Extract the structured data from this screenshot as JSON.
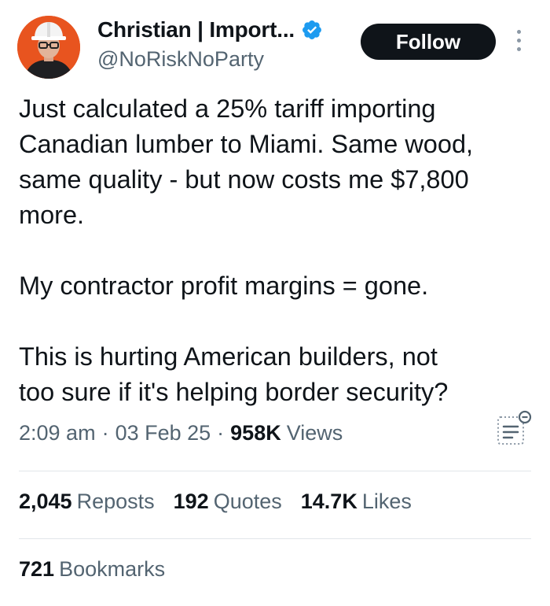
{
  "author": {
    "display_name": "Christian | Import...",
    "handle": "@NoRiskNoParty",
    "verified": true
  },
  "follow_label": "Follow",
  "tweet": {
    "lines_paragraph1": [
      "Just calculated a 25% tariff importing",
      "Canadian lumber to Miami. Same wood,",
      "same quality - but now costs me $7,800",
      "more."
    ],
    "paragraph2": "My contractor profit margins = gone.",
    "lines_paragraph3": [
      "This is hurting American builders, not",
      "too sure if it's helping border security?"
    ]
  },
  "meta": {
    "time": "2:09 am",
    "date": "03 Feb 25",
    "views_count": "958K",
    "views_label": "Views"
  },
  "stats": {
    "reposts_count": "2,045",
    "reposts_label": "Reposts",
    "quotes_count": "192",
    "quotes_label": "Quotes",
    "likes_count": "14.7K",
    "likes_label": "Likes",
    "bookmarks_count": "721",
    "bookmarks_label": "Bookmarks"
  },
  "colors": {
    "text_primary": "#0f1419",
    "text_secondary": "#536471",
    "verified_blue": "#1d9bf0",
    "avatar_bg": "#e8541f",
    "button_bg": "#0f1419"
  },
  "icons": {
    "verified": "verified-badge-icon",
    "more": "more-options-icon",
    "analytics": "post-analytics-icon"
  }
}
